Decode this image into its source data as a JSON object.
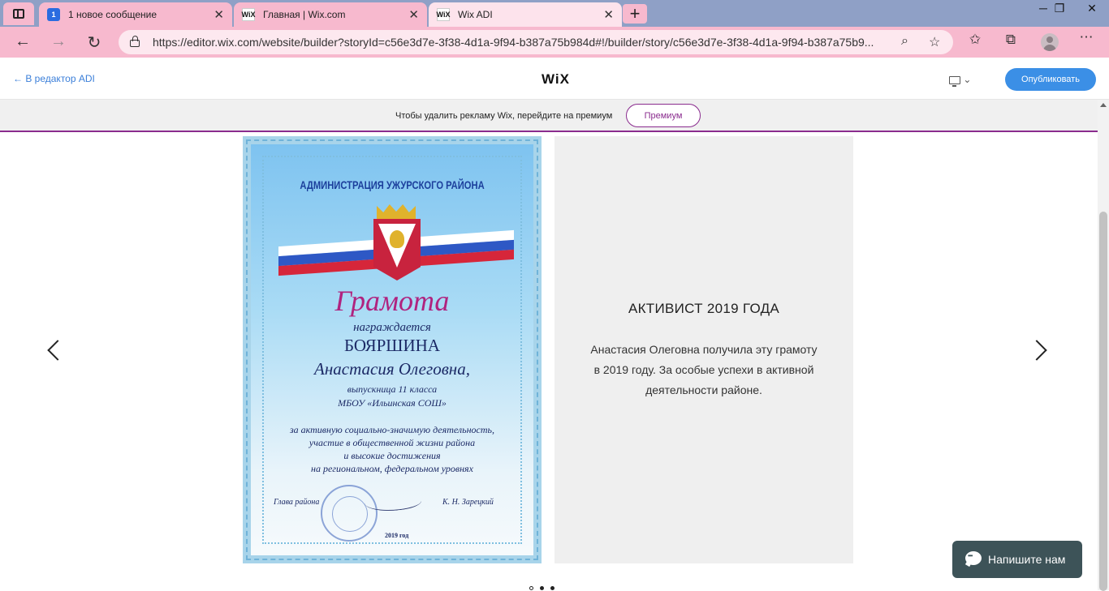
{
  "browser": {
    "tabs": [
      {
        "label": "1 новое сообщение",
        "favicon": "1"
      },
      {
        "label": "Главная | Wix.com",
        "favicon": "WiX"
      },
      {
        "label": "Wix ADI",
        "favicon": "WiX"
      }
    ],
    "url": "https://editor.wix.com/website/builder?storyId=c56e3d7e-3f38-4d1a-9f94-b387a75b984d#!/builder/story/c56e3d7e-3f38-4d1a-9f94-b387a75b9..."
  },
  "editor": {
    "back_label": "← В редактор ADI",
    "logo": "WiX",
    "publish_label": "Опубликовать"
  },
  "promo": {
    "text": "Чтобы удалить рекламу Wix, перейдите на премиум",
    "button": "Премиум"
  },
  "certificate": {
    "header": "АДМИНИСТРАЦИЯ УЖУРСКОГО РАЙОНА",
    "title": "Грамота",
    "line1": "награждается",
    "line2": "БОЯРШИНА",
    "line3": "Анастасия Олеговна,",
    "line4": "выпускница 11 класса",
    "line5": "МБОУ «Ильинская СОШ»",
    "line6": "за активную социально-значимую деятельность,",
    "line7": "участие в общественной жизни района",
    "line8": "и высокие достижения",
    "line9": "на региональном, федеральном уровнях",
    "sign_left": "Глава района",
    "sign_right": "К. Н. Зарецкий",
    "year": "2019 год"
  },
  "slide": {
    "title": "АКТИВИСТ 2019 ГОДА",
    "description": "Анастасия Олеговна получила эту грамоту в 2019 году. За особые успехи в активной деятельности районе."
  },
  "chat": {
    "label": "Напишите нам"
  },
  "colors": {
    "accent": "#3b8fe6",
    "premium": "#8a2c8e",
    "chrome": "#f7b9ce"
  }
}
